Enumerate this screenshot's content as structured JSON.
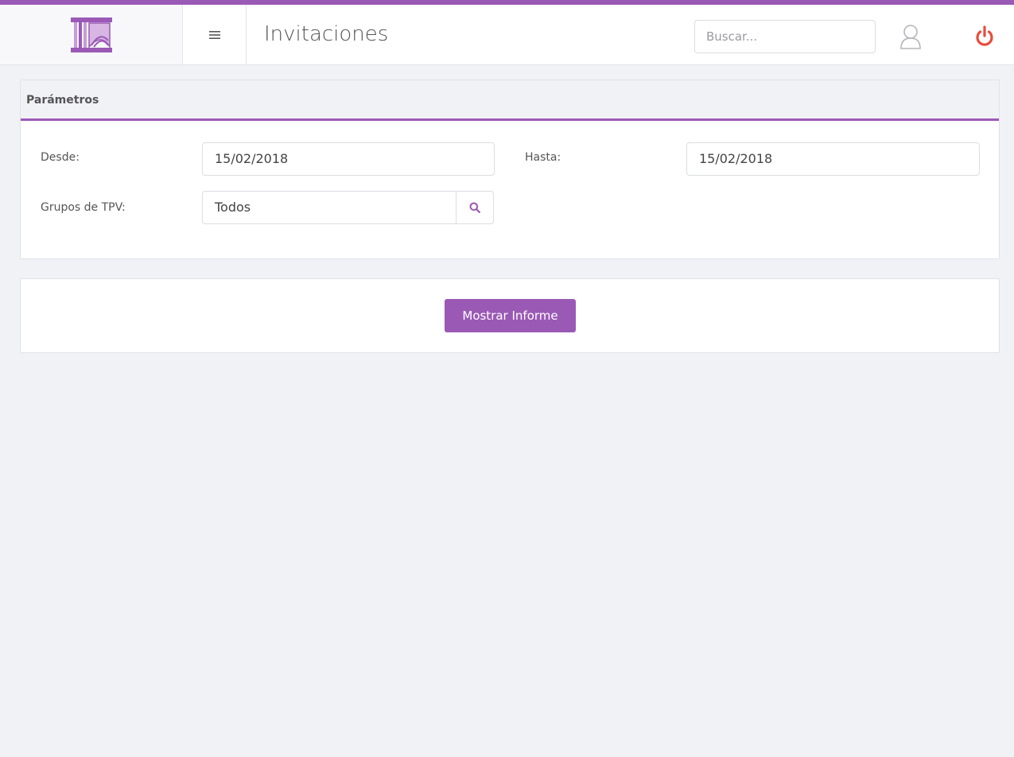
{
  "app": {
    "accent_color": "#9b59b6",
    "logo_icon": "columns-logo-icon"
  },
  "header": {
    "title": "Invitaciones",
    "menu_icon": "hamburger-icon",
    "search": {
      "placeholder": "Buscar...",
      "value": ""
    },
    "user_icon": "user-icon",
    "power_icon": "power-icon",
    "power_color": "#e74c3c"
  },
  "parameters": {
    "heading": "Parámetros",
    "desde": {
      "label": "Desde:",
      "value": "15/02/2018"
    },
    "hasta": {
      "label": "Hasta:",
      "value": "15/02/2018"
    },
    "grupos_tpv": {
      "label": "Grupos de TPV:",
      "value": "Todos",
      "lookup_icon": "search-icon"
    }
  },
  "actions": {
    "show_report_label": "Mostrar Informe"
  }
}
